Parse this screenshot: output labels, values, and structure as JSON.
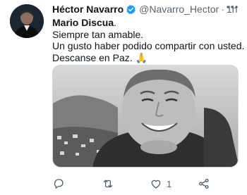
{
  "tweet": {
    "author_name": "Héctor Navarro",
    "handle": "@Navarro_Hector",
    "separator": "·",
    "time": "1h",
    "lines": [
      "Mario Discua",
      ".",
      "Siempre tan amable.",
      "Un gusto haber podido compartir con usted.",
      "Descanse en Paz."
    ],
    "emoji": "🙏",
    "like_count": "1"
  },
  "colors": {
    "verified": "#1d9bf0",
    "secondary_text": "#536471",
    "divider": "#cfd9de"
  },
  "icons": [
    "verified-badge-icon",
    "more-icon",
    "reply-icon",
    "retweet-icon",
    "like-icon",
    "share-icon"
  ]
}
